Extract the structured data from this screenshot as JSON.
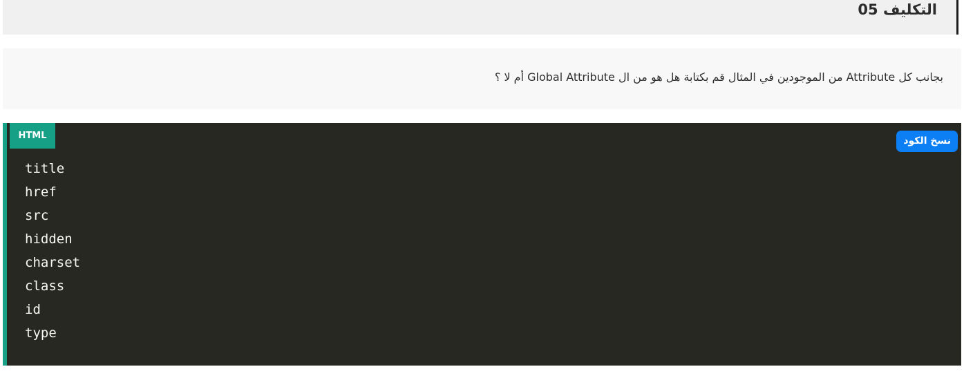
{
  "header": {
    "title": "التكليف 05"
  },
  "question": {
    "text": "بجانب كل Attribute من الموجودين في المثال قم بكتابة هل هو من ال Global Attribute أم لا ؟"
  },
  "code_block": {
    "language_label": "HTML",
    "copy_label": "نسخ الكود",
    "lines": [
      "title",
      "href",
      "src",
      "hidden",
      "charset",
      "class",
      "id",
      "type"
    ]
  }
}
